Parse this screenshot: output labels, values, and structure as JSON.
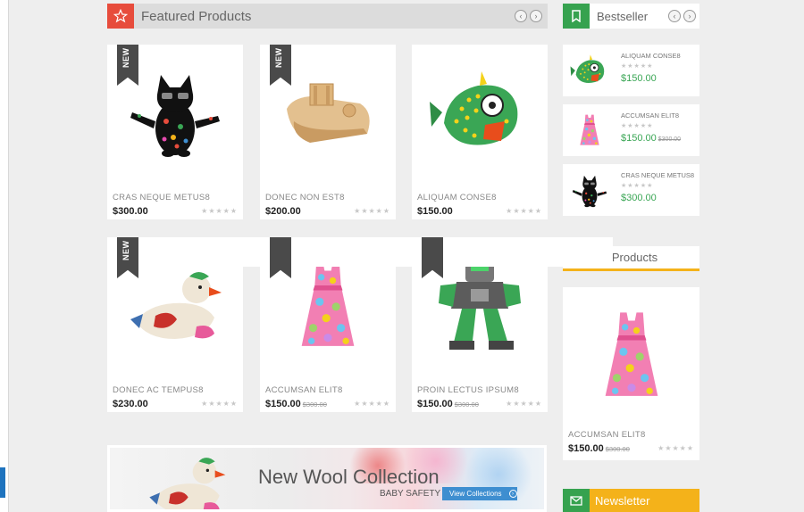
{
  "featured": {
    "title": "Featured Products",
    "prev_icon": "chevron-left-icon",
    "next_icon": "chevron-right-icon",
    "accent": "#e74c3c"
  },
  "products": [
    {
      "badge": "NEW",
      "name": "CRAS NEQUE METUS8",
      "price": "$300.00",
      "old_price": "",
      "rating": 0,
      "image": "cat-toy"
    },
    {
      "badge": "NEW",
      "name": "DONEC NON EST8",
      "price": "$200.00",
      "old_price": "",
      "rating": 0,
      "image": "wooden-boat"
    },
    {
      "badge": "",
      "name": "ALIQUAM CONSE8",
      "price": "$150.00",
      "old_price": "",
      "rating": 0,
      "image": "green-fish"
    },
    {
      "badge": "NEW",
      "name": "DONEC AC TEMPUS8",
      "price": "$230.00",
      "old_price": "",
      "rating": 0,
      "image": "knitted-bird"
    },
    {
      "badge": "",
      "name": "ACCUMSAN ELIT8",
      "price": "$150.00",
      "old_price": "$300.00",
      "rating": 0,
      "image": "floral-dress"
    },
    {
      "badge": "",
      "name": "PROIN LECTUS IPSUM8",
      "price": "$150.00",
      "old_price": "$300.00",
      "rating": 0,
      "image": "robot-toy"
    }
  ],
  "bestseller": {
    "title": "Bestseller",
    "accent": "#36a24f",
    "icon": "bookmark-icon",
    "items": [
      {
        "name": "ALIQUAM CONSE8",
        "price": "$150.00",
        "old_price": "",
        "image": "green-fish"
      },
      {
        "name": "ACCUMSAN ELIT8",
        "price": "$150.00",
        "old_price": "$300.00",
        "image": "floral-dress"
      },
      {
        "name": "CRAS NEQUE METUS8",
        "price": "$300.00",
        "old_price": "",
        "image": "cat-toy"
      }
    ]
  },
  "sale": {
    "title_fragment": "e Products",
    "accent": "#f4b21a",
    "product": {
      "name": "ACCUMSAN ELIT8",
      "price": "$150.00",
      "old_price": "$300.00",
      "image": "floral-dress"
    }
  },
  "banner": {
    "title": "New Wool Collection",
    "subtitle": "BABY SAFETY",
    "button": "View Collections",
    "image": "knitted-bird"
  },
  "newsletter": {
    "title": "Newsletter",
    "icon": "envelope-icon"
  },
  "stars_text": "★★★★★"
}
